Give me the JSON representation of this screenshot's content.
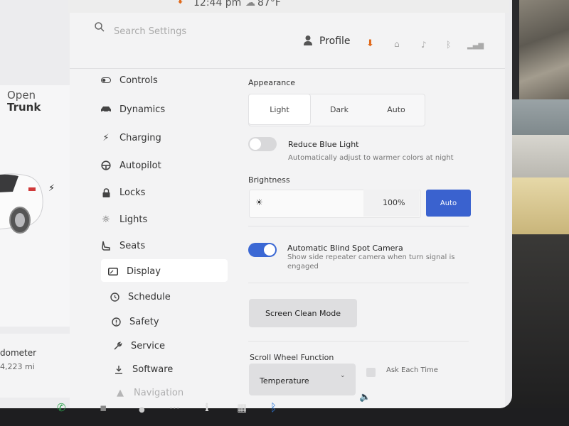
{
  "status": {
    "time": "12:44 pm",
    "temperature": "87°F"
  },
  "car": {
    "trunk_line1": "Open",
    "trunk_line2": "Trunk",
    "odometer_label": "dometer",
    "odometer_value": "4,223 mi"
  },
  "header": {
    "search_placeholder": "Search Settings",
    "profile_label": "Profile"
  },
  "nav": {
    "items": [
      {
        "label": "Controls",
        "icon": "toggle-icon"
      },
      {
        "label": "Dynamics",
        "icon": "car-icon"
      },
      {
        "label": "Charging",
        "icon": "bolt-icon"
      },
      {
        "label": "Autopilot",
        "icon": "steering-wheel-icon"
      },
      {
        "label": "Locks",
        "icon": "lock-icon"
      },
      {
        "label": "Lights",
        "icon": "light-icon"
      },
      {
        "label": "Seats",
        "icon": "seat-icon"
      },
      {
        "label": "Display",
        "icon": "display-icon"
      },
      {
        "label": "Schedule",
        "icon": "clock-icon"
      },
      {
        "label": "Safety",
        "icon": "safety-icon"
      },
      {
        "label": "Service",
        "icon": "wrench-icon"
      },
      {
        "label": "Software",
        "icon": "download-icon"
      },
      {
        "label": "Navigation",
        "icon": "navigation-icon"
      }
    ],
    "active": "Display"
  },
  "display": {
    "appearance_label": "Appearance",
    "appearance_options": [
      "Light",
      "Dark",
      "Auto"
    ],
    "appearance_selected": "Light",
    "reduce_blue_light": {
      "title": "Reduce Blue Light",
      "description": "Automatically adjust to warmer colors at night",
      "enabled": false
    },
    "brightness_label": "Brightness",
    "brightness_value": "100%",
    "brightness_auto_label": "Auto",
    "blind_spot": {
      "title": "Automatic Blind Spot Camera",
      "description_line1": "Show side repeater camera when turn signal is",
      "description_line2": "engaged",
      "enabled": true
    },
    "screen_clean_label": "Screen Clean Mode",
    "scroll_wheel_label": "Scroll Wheel Function",
    "scroll_wheel_value": "Temperature",
    "ask_each_time_label": "Ask Each Time"
  },
  "colors": {
    "accent": "#3b68d4",
    "download": "#e06a1c",
    "phone": "#2ea44f",
    "bluetooth": "#2f7bdc"
  }
}
